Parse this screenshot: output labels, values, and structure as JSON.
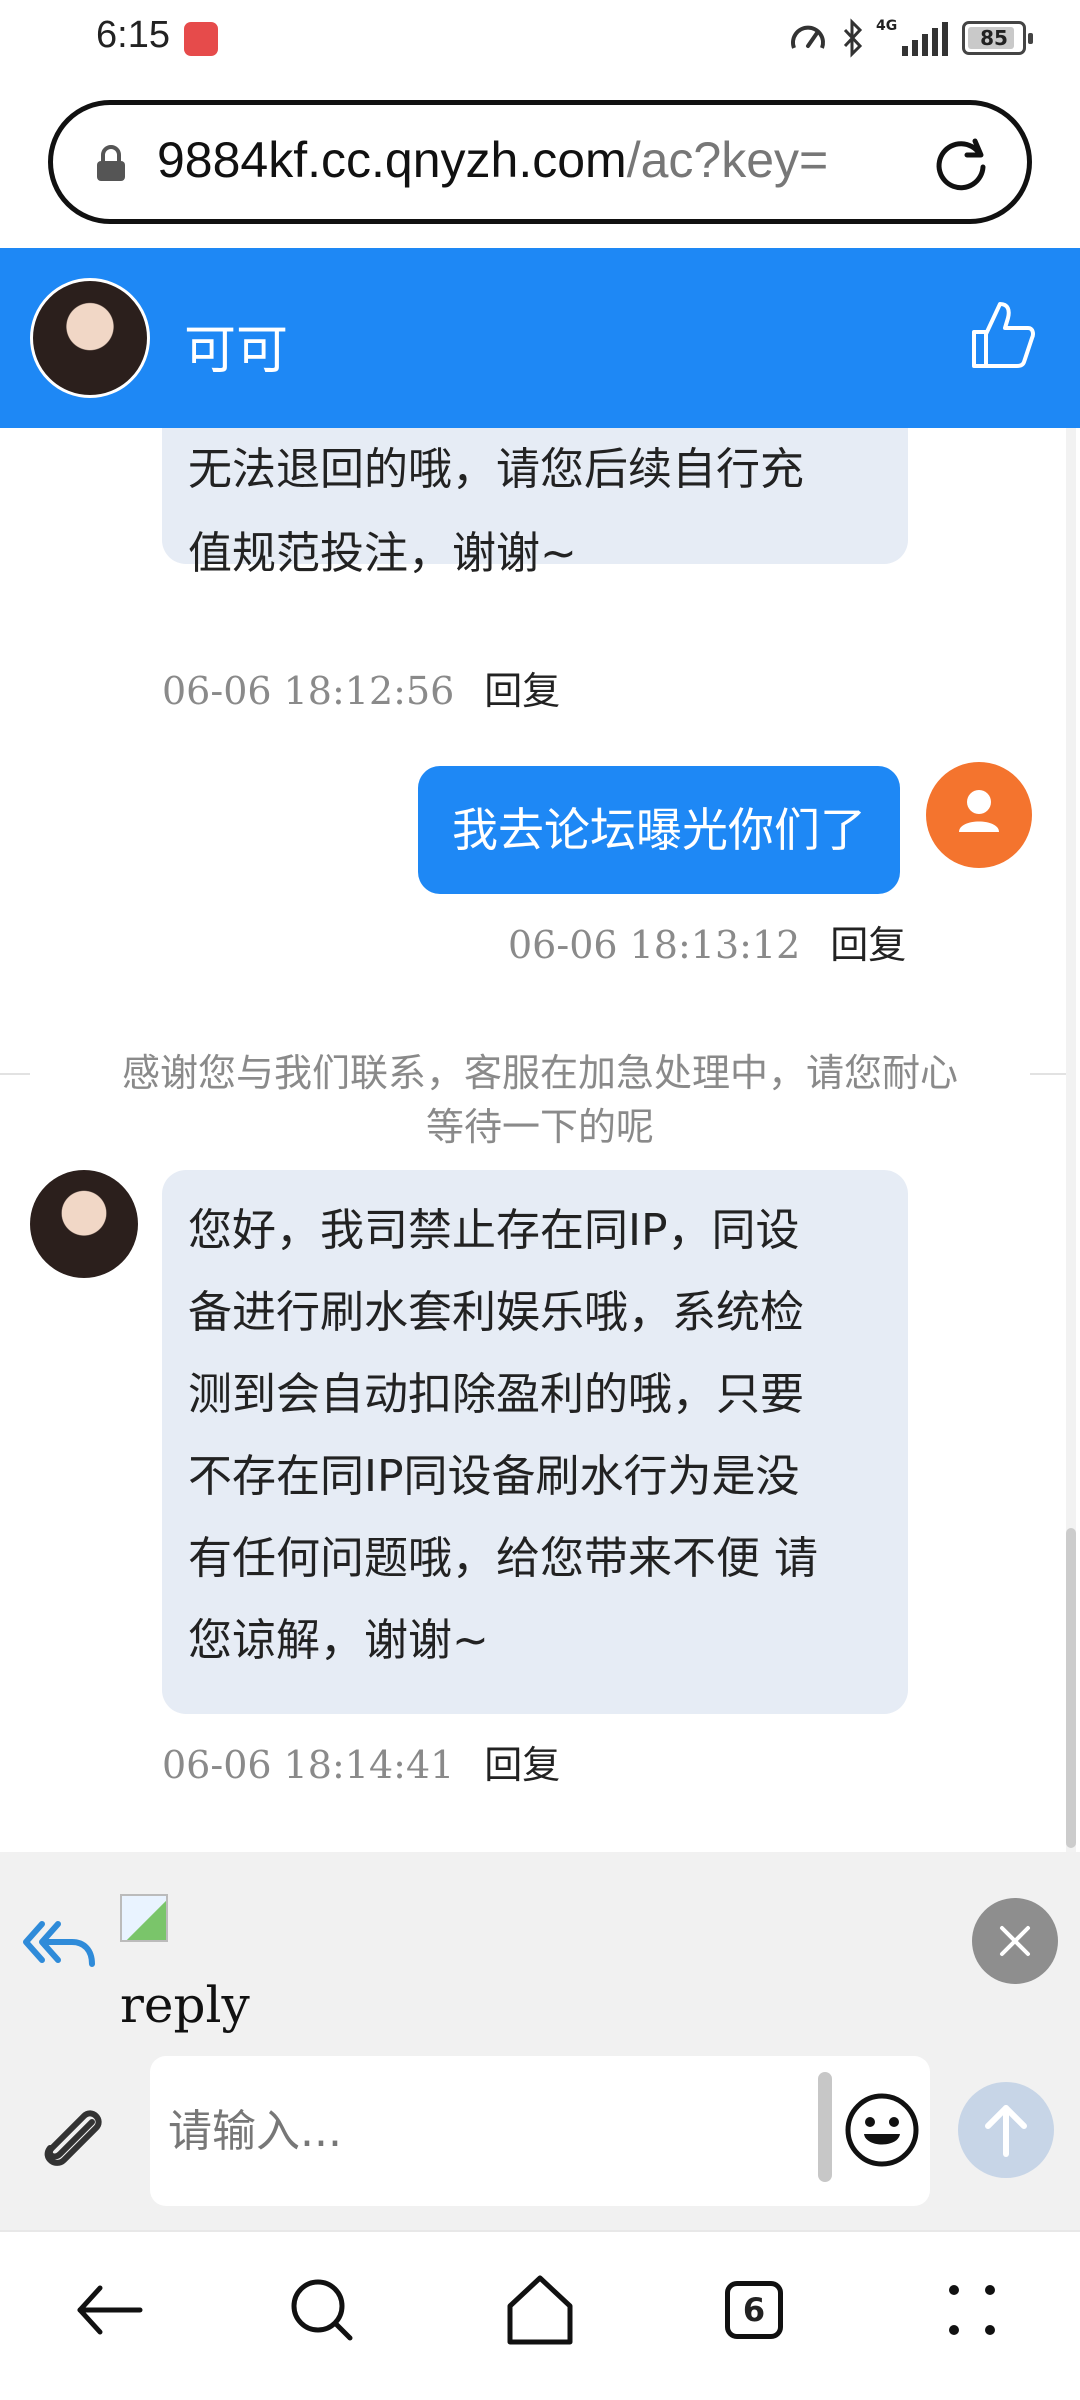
{
  "status_bar": {
    "time": "6:15",
    "network": "4G",
    "battery": "85"
  },
  "browser": {
    "url_main": "9884kf.cc.qnyzh.com",
    "url_rest": "/ac?key="
  },
  "chat_header": {
    "contact_name": "可可",
    "colors": {
      "header_bg": "#1e88f5"
    }
  },
  "messages": [
    {
      "direction": "incoming",
      "text_lines": [
        "无法退回的哦，请您后续自行充",
        "值规范投注，谢谢~"
      ],
      "time": "06-06 18:12:56",
      "reply_label": "回复"
    },
    {
      "direction": "outgoing",
      "text": "我去论坛曝光你们了",
      "time": "06-06 18:13:12",
      "reply_label": "回复"
    },
    {
      "direction": "system",
      "text_lines": [
        "感谢您与我们联系，客服在加急处理中，请您耐心",
        "等待一下的呢"
      ]
    },
    {
      "direction": "incoming",
      "text_lines": [
        "您好，我司禁止存在同IP，同设",
        "备进行刷水套利娱乐哦，系统检",
        "测到会自动扣除盈利的哦，只要",
        "不存在同IP同设备刷水行为是没",
        "有任何问题哦，给您带来不便 请",
        "您谅解，谢谢~"
      ],
      "time": "06-06 18:14:41",
      "reply_label": "回复"
    }
  ],
  "reply_preview": {
    "text": "reply"
  },
  "composer": {
    "placeholder": "请输入..."
  },
  "bottom_nav": {
    "tabs_count": "6"
  }
}
